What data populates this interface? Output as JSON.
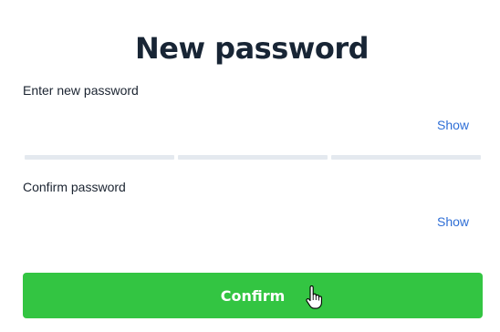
{
  "header": {
    "title": "New password"
  },
  "new_password": {
    "label": "Enter new password",
    "value": "",
    "placeholder": "",
    "show_label": "Show"
  },
  "strength_meter": {
    "segments": 3,
    "filled": 0
  },
  "confirm_password": {
    "label": "Confirm password",
    "value": "",
    "placeholder": "",
    "show_label": "Show"
  },
  "actions": {
    "confirm_label": "Confirm"
  },
  "colors": {
    "accent_green": "#33c542",
    "link_blue": "#2f6fd6",
    "title_dark": "#182535",
    "meter_empty": "#e4e9ef"
  },
  "icons": {
    "cursor": "hand-pointer-icon"
  }
}
